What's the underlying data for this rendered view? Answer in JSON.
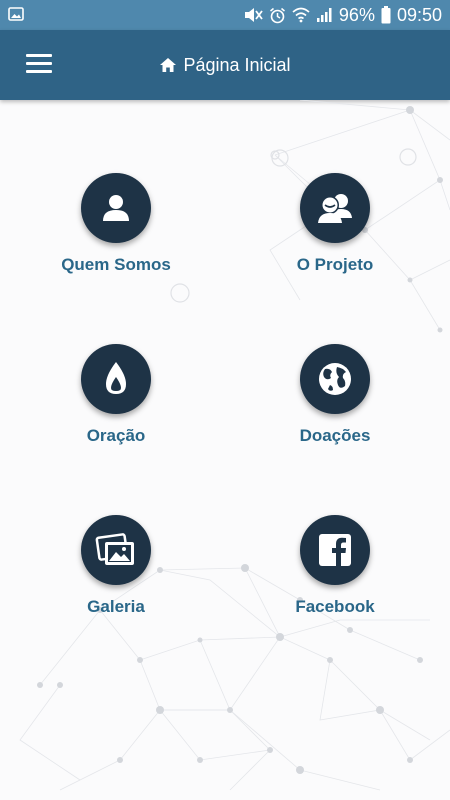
{
  "status_bar": {
    "battery": "96%",
    "time": "09:50",
    "icons": [
      "image-icon",
      "mute-icon",
      "alarm-icon",
      "wifi-icon",
      "signal-icon",
      "battery-icon"
    ]
  },
  "app_bar": {
    "title": "Página Inicial",
    "menu_icon": "hamburger-menu-icon",
    "title_icon": "home-icon"
  },
  "menu": [
    {
      "label": "Quem Somos",
      "icon": "person-icon"
    },
    {
      "label": "O Projeto",
      "icon": "group-icon"
    },
    {
      "label": "Oração",
      "icon": "flame-icon"
    },
    {
      "label": "Doações",
      "icon": "globe-icon"
    },
    {
      "label": "Galeria",
      "icon": "photo-gallery-icon"
    },
    {
      "label": "Facebook",
      "icon": "facebook-icon"
    }
  ],
  "colors": {
    "status_bar": "#4f88ad",
    "app_bar": "#2f6386",
    "circle": "#1e3346",
    "label": "#2a6789",
    "background": "#fbfbfc"
  }
}
